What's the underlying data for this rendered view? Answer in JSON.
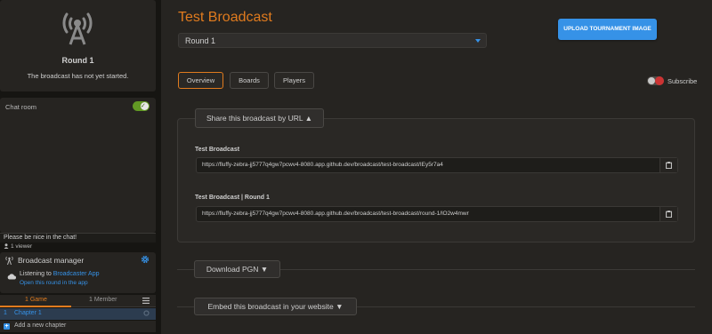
{
  "round_box": {
    "name": "Round 1",
    "status": "The broadcast has not yet started."
  },
  "chat": {
    "label": "Chat room",
    "enabled": true,
    "input_placeholder": "Please be nice in the chat!",
    "viewers": "1 viewer"
  },
  "manager": {
    "title": "Broadcast manager",
    "listening_prefix": "Listening to ",
    "app_name": "Broadcaster App",
    "open_link": "Open this round in the app"
  },
  "study_tabs": {
    "games": "1 Game",
    "members": "1 Member"
  },
  "chapters": [
    {
      "number": "1",
      "name": "Chapter 1"
    }
  ],
  "add_chapter": "Add a new chapter",
  "main": {
    "title": "Test Broadcast",
    "round_select": "Round 1",
    "upload_button": "UPLOAD TOURNAMENT IMAGE",
    "tabs": [
      "Overview",
      "Boards",
      "Players"
    ],
    "active_tab": "Overview",
    "subscribe_label": "Subscribe",
    "subscribed": false
  },
  "share": {
    "toggle_label": "Share this broadcast by URL ▲",
    "urls": [
      {
        "label": "Test Broadcast",
        "url": "https://fluffy-zebra-jj5777q4gw7pcwv4-8080.app.github.dev/broadcast/test-broadcast/IEy5r7a4"
      },
      {
        "label": "Test Broadcast | Round 1",
        "url": "https://fluffy-zebra-jj5777q4gw7pcwv4-8080.app.github.dev/broadcast/test-broadcast/round-1/lO2w4mwr"
      }
    ]
  },
  "download_pgn": "Download PGN ▼",
  "embed": "Embed this broadcast in your website ▼",
  "colors": {
    "accent": "#e07b1e",
    "link": "#3692e7",
    "toggle_on": "#629924",
    "toggle_off": "#cc3333"
  }
}
